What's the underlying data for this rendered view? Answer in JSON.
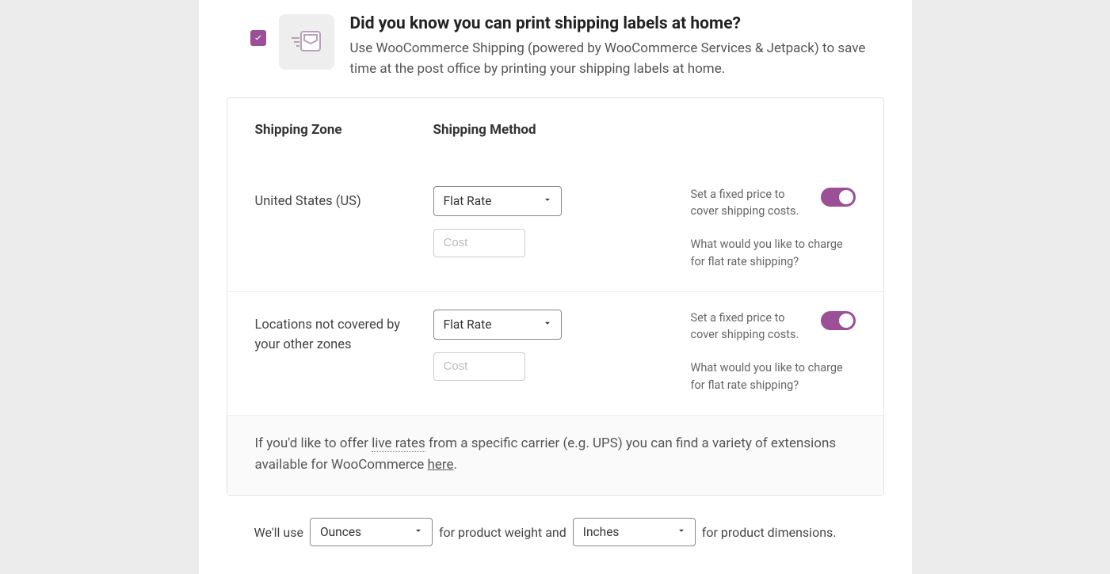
{
  "promo": {
    "title": "Did you know you can print shipping labels at home?",
    "body": "Use WooCommerce Shipping (powered by WooCommerce Services & Jetpack) to save time at the post office by printing your shipping labels at home."
  },
  "headers": {
    "zone": "Shipping Zone",
    "method": "Shipping Method"
  },
  "zones": [
    {
      "name": "United States (US)",
      "method_selected": "Flat Rate",
      "method_desc": "Set a fixed price to cover shipping costs.",
      "cost_placeholder": "Cost",
      "cost_value": "",
      "cost_desc": "What would you like to charge for flat rate shipping?",
      "enabled": true
    },
    {
      "name": "Locations not covered by your other zones",
      "method_selected": "Flat Rate",
      "method_desc": "Set a fixed price to cover shipping costs.",
      "cost_placeholder": "Cost",
      "cost_value": "",
      "cost_desc": "What would you like to charge for flat rate shipping?",
      "enabled": true
    }
  ],
  "live_rates": {
    "prefix": "If you'd like to offer ",
    "term": "live rates",
    "middle": " from a specific carrier (e.g. UPS) you can find a variety of extensions available for WooCommerce ",
    "link": "here",
    "suffix": "."
  },
  "units": {
    "pre": "We'll use",
    "weight_selected": "Ounces",
    "mid": "for product weight and",
    "dimension_selected": "Inches",
    "post": "for product dimensions."
  },
  "colors": {
    "accent": "#9b4f96"
  }
}
